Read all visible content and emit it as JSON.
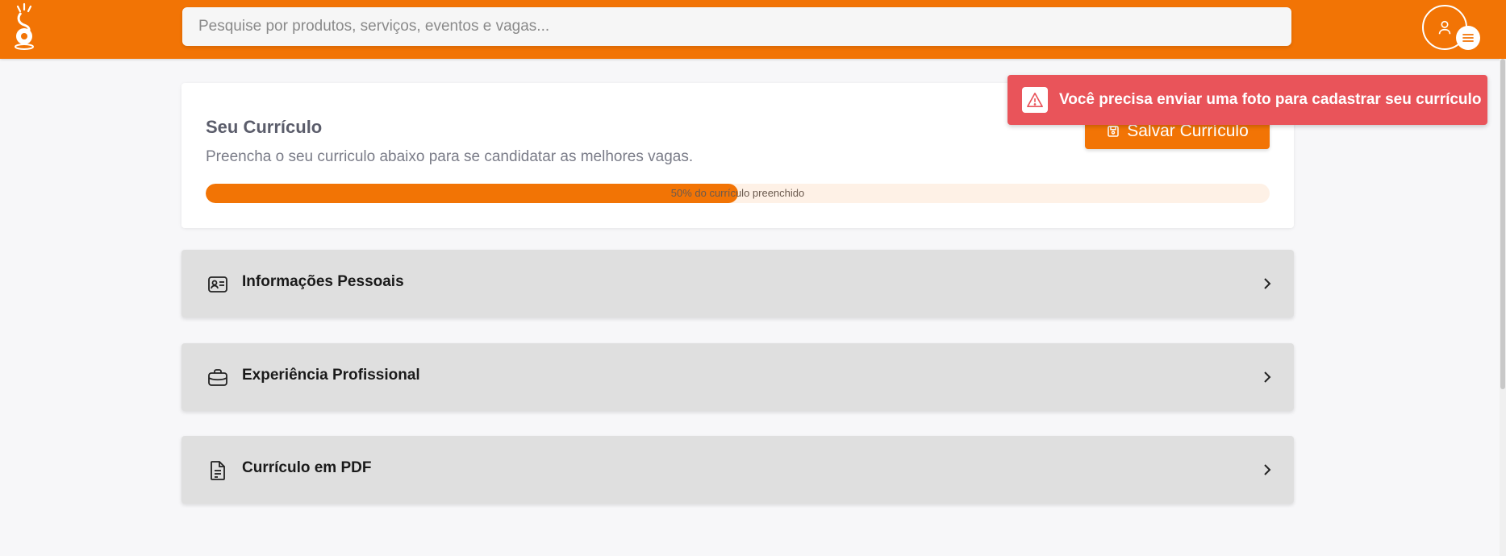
{
  "header": {
    "search_placeholder": "Pesquise por produtos, serviços, eventos e vagas..."
  },
  "resume": {
    "title": "Seu Currículo",
    "subtitle": "Preencha o seu curriculo abaixo para se candidatar as melhores vagas.",
    "save_label": "Salvar Currículo",
    "progress_percent": 50,
    "progress_label": "50% do currículo preenchido"
  },
  "sections": [
    {
      "label": "Informações Pessoais",
      "icon": "id-card-icon"
    },
    {
      "label": "Experiência Profissional",
      "icon": "briefcase-icon"
    },
    {
      "label": "Currículo em PDF",
      "icon": "document-icon"
    }
  ],
  "toast": {
    "message": "Você precisa enviar uma foto para cadastrar seu currículo",
    "icon": "warning-icon"
  },
  "colors": {
    "brand": "#f27405",
    "danger": "#e9545a"
  }
}
